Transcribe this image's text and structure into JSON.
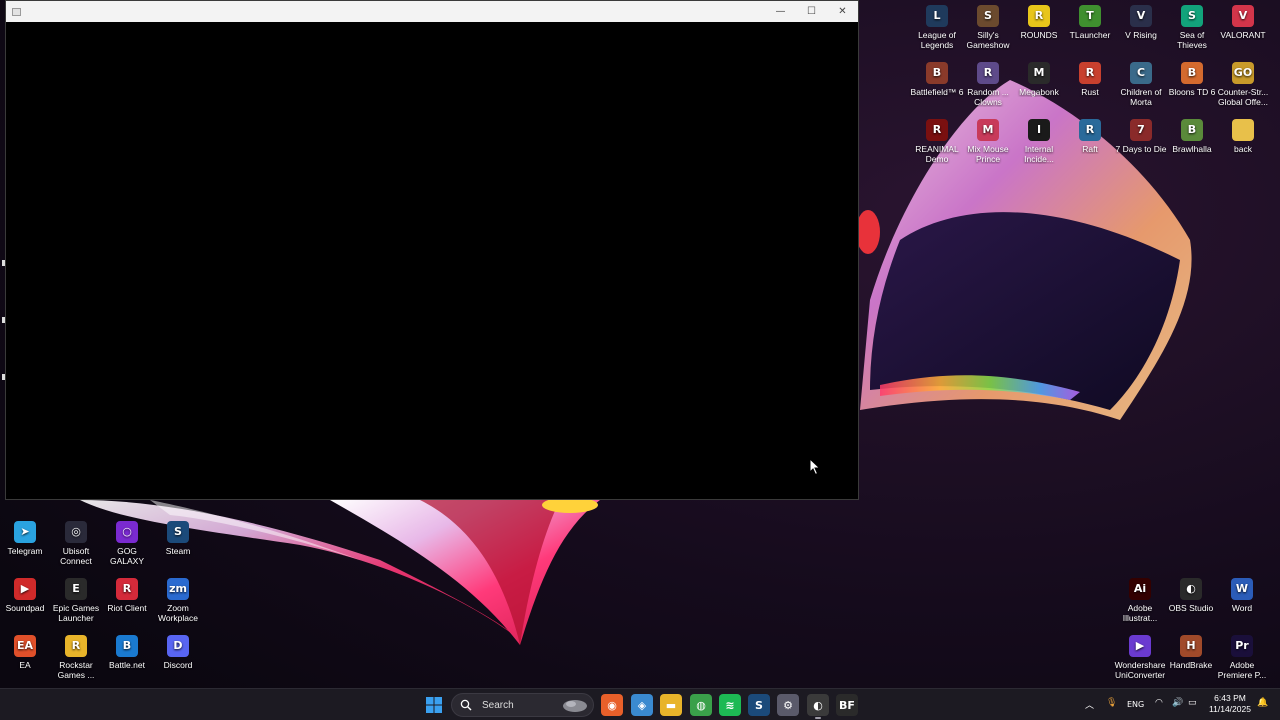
{
  "window": {
    "minimize_glyph": "—",
    "maximize_glyph": "☐",
    "close_glyph": "✕"
  },
  "desktop_right": [
    {
      "label": "League of Legends",
      "icon": "league-of-legends-icon",
      "color": "#1f3a5c",
      "glyph": "L"
    },
    {
      "label": "Silly's Gameshow",
      "icon": "sillys-gameshow-icon",
      "color": "#6b4a2e",
      "glyph": "S"
    },
    {
      "label": "ROUNDS",
      "icon": "rounds-icon",
      "color": "#e8c51a",
      "glyph": "R"
    },
    {
      "label": "TLauncher",
      "icon": "tlauncher-icon",
      "color": "#3f8f2f",
      "glyph": "T"
    },
    {
      "label": "V Rising",
      "icon": "v-rising-icon",
      "color": "#2a2f4a",
      "glyph": "V"
    },
    {
      "label": "Sea of Thieves",
      "icon": "sea-of-thieves-icon",
      "color": "#12a37b",
      "glyph": "S"
    },
    {
      "label": "VALORANT",
      "icon": "valorant-icon",
      "color": "#d3354a",
      "glyph": "V"
    },
    {
      "label": "Battlefield™ 6",
      "icon": "battlefield-icon",
      "color": "#8a3a2a",
      "glyph": "B"
    },
    {
      "label": "Random ... Clowns",
      "icon": "random-clowns-icon",
      "color": "#5e4a8a",
      "glyph": "R"
    },
    {
      "label": "Megabonk",
      "icon": "megabonk-icon",
      "color": "#2a2a2a",
      "glyph": "M"
    },
    {
      "label": "Rust",
      "icon": "rust-icon",
      "color": "#c8402e",
      "glyph": "R"
    },
    {
      "label": "Children of Morta",
      "icon": "children-of-morta-icon",
      "color": "#3a6a8a",
      "glyph": "C"
    },
    {
      "label": "Bloons TD 6",
      "icon": "bloons-td6-icon",
      "color": "#d46a2e",
      "glyph": "B"
    },
    {
      "label": "Counter-Str... Global Offe...",
      "icon": "counter-strike-icon",
      "color": "#c89a2a",
      "glyph": "GO"
    },
    {
      "label": "REANIMAL Demo",
      "icon": "reanimal-icon",
      "color": "#7a1010",
      "glyph": "R"
    },
    {
      "label": "Mix Mouse Prince",
      "icon": "mix-mouse-icon",
      "color": "#c83a5a",
      "glyph": "M"
    },
    {
      "label": "Internal Incide...",
      "icon": "internal-incident-icon",
      "color": "#1a1a1a",
      "glyph": "I"
    },
    {
      "label": "Raft",
      "icon": "raft-icon",
      "color": "#2a6a9a",
      "glyph": "R"
    },
    {
      "label": "7 Days to Die",
      "icon": "seven-days-icon",
      "color": "#8a2a2a",
      "glyph": "7"
    },
    {
      "label": "Brawlhalla",
      "icon": "brawlhalla-icon",
      "color": "#5a8a3a",
      "glyph": "B"
    },
    {
      "label": "back",
      "icon": "folder-icon",
      "color": "#e8c04a",
      "glyph": ""
    }
  ],
  "desktop_left": [
    {
      "label": "Telegram",
      "icon": "telegram-icon",
      "color": "#2aa3e0",
      "glyph": "➤"
    },
    {
      "label": "Ubisoft Connect",
      "icon": "ubisoft-connect-icon",
      "color": "#2a2a3a",
      "glyph": "◎"
    },
    {
      "label": "GOG GALAXY",
      "icon": "gog-galaxy-icon",
      "color": "#7a2ad0",
      "glyph": "○"
    },
    {
      "label": "Steam",
      "icon": "steam-icon",
      "color": "#1b4a7a",
      "glyph": "S"
    },
    {
      "label": "Soundpad",
      "icon": "soundpad-icon",
      "color": "#d02a2a",
      "glyph": "▶"
    },
    {
      "label": "Epic Games Launcher",
      "icon": "epic-games-icon",
      "color": "#2a2a2a",
      "glyph": "E"
    },
    {
      "label": "Riot Client",
      "icon": "riot-client-icon",
      "color": "#d42a3a",
      "glyph": "R"
    },
    {
      "label": "Zoom Workplace",
      "icon": "zoom-icon",
      "color": "#2a6ad0",
      "glyph": "zm"
    },
    {
      "label": "EA",
      "icon": "ea-icon",
      "color": "#e0502a",
      "glyph": "EA"
    },
    {
      "label": "Rockstar Games ...",
      "icon": "rockstar-icon",
      "color": "#e8b42a",
      "glyph": "R"
    },
    {
      "label": "Battle.net",
      "icon": "battlenet-icon",
      "color": "#1a7ad0",
      "glyph": "B"
    },
    {
      "label": "Discord",
      "icon": "discord-icon",
      "color": "#5865f2",
      "glyph": "D"
    }
  ],
  "desktop_bottom_right": [
    {
      "label": "Adobe Illustrat...",
      "icon": "adobe-illustrator-icon",
      "color": "#330000",
      "glyph": "Ai"
    },
    {
      "label": "OBS Studio",
      "icon": "obs-studio-icon",
      "color": "#2a2a2a",
      "glyph": "◐"
    },
    {
      "label": "Word",
      "icon": "word-icon",
      "color": "#2b5cb8",
      "glyph": "W"
    },
    {
      "label": "Wondershare UniConverter",
      "icon": "uniconverter-icon",
      "color": "#6a3ad0",
      "glyph": "▶"
    },
    {
      "label": "HandBrake",
      "icon": "handbrake-icon",
      "color": "#a04a2a",
      "glyph": "H"
    },
    {
      "label": "Adobe Premiere P...",
      "icon": "adobe-premiere-icon",
      "color": "#1a0f3a",
      "glyph": "Pr"
    }
  ],
  "taskbar": {
    "search_placeholder": "Search",
    "pinned": [
      {
        "name": "firefox-icon",
        "color": "#e8602a",
        "glyph": "◉"
      },
      {
        "name": "copilot-icon",
        "color": "#3a8ad0",
        "glyph": "◈"
      },
      {
        "name": "file-explorer-icon",
        "color": "#e8b42a",
        "glyph": "▬"
      },
      {
        "name": "chrome-icon",
        "color": "#3aa04a",
        "glyph": "◍"
      },
      {
        "name": "spotify-icon",
        "color": "#1db954",
        "glyph": "≋"
      },
      {
        "name": "steam-taskbar-icon",
        "color": "#1b4a7a",
        "glyph": "S"
      },
      {
        "name": "settings-icon",
        "color": "#5a5a6a",
        "glyph": "⚙"
      },
      {
        "name": "obs-taskbar-icon",
        "color": "#3a3a3a",
        "glyph": "◐"
      },
      {
        "name": "battlefield-taskbar-icon",
        "color": "#2a2a2a",
        "glyph": "BF"
      }
    ],
    "language": "ENG",
    "time": "6:43 PM",
    "date": "11/14/2025"
  }
}
